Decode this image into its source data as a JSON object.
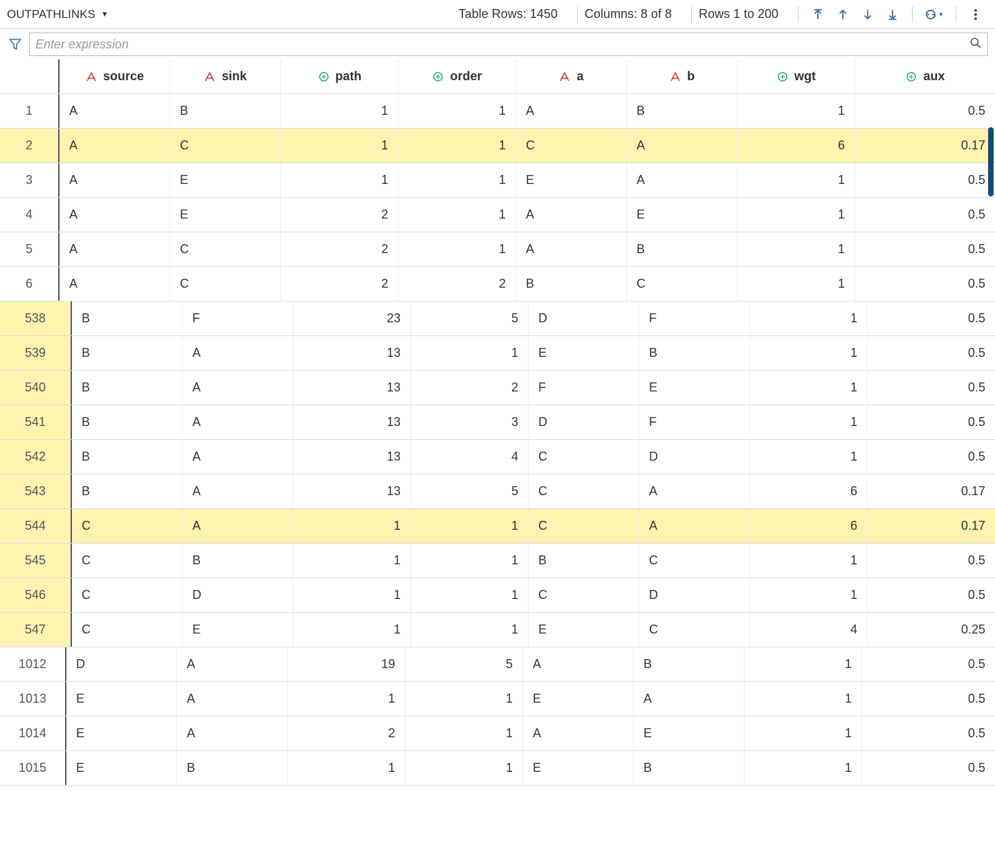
{
  "toolbar": {
    "table_name": "OUTPATHLINKS",
    "rows_label": "Table Rows: 1450",
    "cols_label": "Columns: 8 of 8",
    "range_label": "Rows 1 to 200"
  },
  "filter": {
    "placeholder": "Enter expression"
  },
  "columns": [
    {
      "key": "source",
      "label": "source",
      "type": "char"
    },
    {
      "key": "sink",
      "label": "sink",
      "type": "char"
    },
    {
      "key": "path",
      "label": "path",
      "type": "num"
    },
    {
      "key": "order",
      "label": "order",
      "type": "num"
    },
    {
      "key": "a",
      "label": "a",
      "type": "char"
    },
    {
      "key": "b",
      "label": "b",
      "type": "char"
    },
    {
      "key": "wgt",
      "label": "wgt",
      "type": "num"
    },
    {
      "key": "aux",
      "label": "aux",
      "type": "num"
    }
  ],
  "sections": [
    {
      "id": "a",
      "rows": [
        {
          "n": "1",
          "source": "A",
          "sink": "B",
          "path": "1",
          "order": "1",
          "a": "A",
          "b": "B",
          "wgt": "1",
          "aux": "0.5",
          "hl": false
        },
        {
          "n": "2",
          "source": "A",
          "sink": "C",
          "path": "1",
          "order": "1",
          "a": "C",
          "b": "A",
          "wgt": "6",
          "aux": "0.17",
          "hl": true
        },
        {
          "n": "3",
          "source": "A",
          "sink": "E",
          "path": "1",
          "order": "1",
          "a": "E",
          "b": "A",
          "wgt": "1",
          "aux": "0.5",
          "hl": false
        },
        {
          "n": "4",
          "source": "A",
          "sink": "E",
          "path": "2",
          "order": "1",
          "a": "A",
          "b": "E",
          "wgt": "1",
          "aux": "0.5",
          "hl": false
        },
        {
          "n": "5",
          "source": "A",
          "sink": "C",
          "path": "2",
          "order": "1",
          "a": "A",
          "b": "B",
          "wgt": "1",
          "aux": "0.5",
          "hl": false
        },
        {
          "n": "6",
          "source": "A",
          "sink": "C",
          "path": "2",
          "order": "2",
          "a": "B",
          "b": "C",
          "wgt": "1",
          "aux": "0.5",
          "hl": false
        }
      ]
    },
    {
      "id": "b",
      "rows": [
        {
          "n": "538",
          "source": "B",
          "sink": "F",
          "path": "23",
          "order": "5",
          "a": "D",
          "b": "F",
          "wgt": "1",
          "aux": "0.5",
          "hl": false
        },
        {
          "n": "539",
          "source": "B",
          "sink": "A",
          "path": "13",
          "order": "1",
          "a": "E",
          "b": "B",
          "wgt": "1",
          "aux": "0.5",
          "hl": false
        },
        {
          "n": "540",
          "source": "B",
          "sink": "A",
          "path": "13",
          "order": "2",
          "a": "F",
          "b": "E",
          "wgt": "1",
          "aux": "0.5",
          "hl": false
        },
        {
          "n": "541",
          "source": "B",
          "sink": "A",
          "path": "13",
          "order": "3",
          "a": "D",
          "b": "F",
          "wgt": "1",
          "aux": "0.5",
          "hl": false
        },
        {
          "n": "542",
          "source": "B",
          "sink": "A",
          "path": "13",
          "order": "4",
          "a": "C",
          "b": "D",
          "wgt": "1",
          "aux": "0.5",
          "hl": false
        },
        {
          "n": "543",
          "source": "B",
          "sink": "A",
          "path": "13",
          "order": "5",
          "a": "C",
          "b": "A",
          "wgt": "6",
          "aux": "0.17",
          "hl": false
        },
        {
          "n": "544",
          "source": "C",
          "sink": "A",
          "path": "1",
          "order": "1",
          "a": "C",
          "b": "A",
          "wgt": "6",
          "aux": "0.17",
          "hl": true
        },
        {
          "n": "545",
          "source": "C",
          "sink": "B",
          "path": "1",
          "order": "1",
          "a": "B",
          "b": "C",
          "wgt": "1",
          "aux": "0.5",
          "hl": false
        },
        {
          "n": "546",
          "source": "C",
          "sink": "D",
          "path": "1",
          "order": "1",
          "a": "C",
          "b": "D",
          "wgt": "1",
          "aux": "0.5",
          "hl": false
        },
        {
          "n": "547",
          "source": "C",
          "sink": "E",
          "path": "1",
          "order": "1",
          "a": "E",
          "b": "C",
          "wgt": "4",
          "aux": "0.25",
          "hl": false
        }
      ]
    },
    {
      "id": "c",
      "rows": [
        {
          "n": "1012",
          "source": "D",
          "sink": "A",
          "path": "19",
          "order": "5",
          "a": "A",
          "b": "B",
          "wgt": "1",
          "aux": "0.5",
          "hl": false
        },
        {
          "n": "1013",
          "source": "E",
          "sink": "A",
          "path": "1",
          "order": "1",
          "a": "E",
          "b": "A",
          "wgt": "1",
          "aux": "0.5",
          "hl": false
        },
        {
          "n": "1014",
          "source": "E",
          "sink": "A",
          "path": "2",
          "order": "1",
          "a": "A",
          "b": "E",
          "wgt": "1",
          "aux": "0.5",
          "hl": false
        },
        {
          "n": "1015",
          "source": "E",
          "sink": "B",
          "path": "1",
          "order": "1",
          "a": "E",
          "b": "B",
          "wgt": "1",
          "aux": "0.5",
          "hl": false
        }
      ]
    }
  ]
}
